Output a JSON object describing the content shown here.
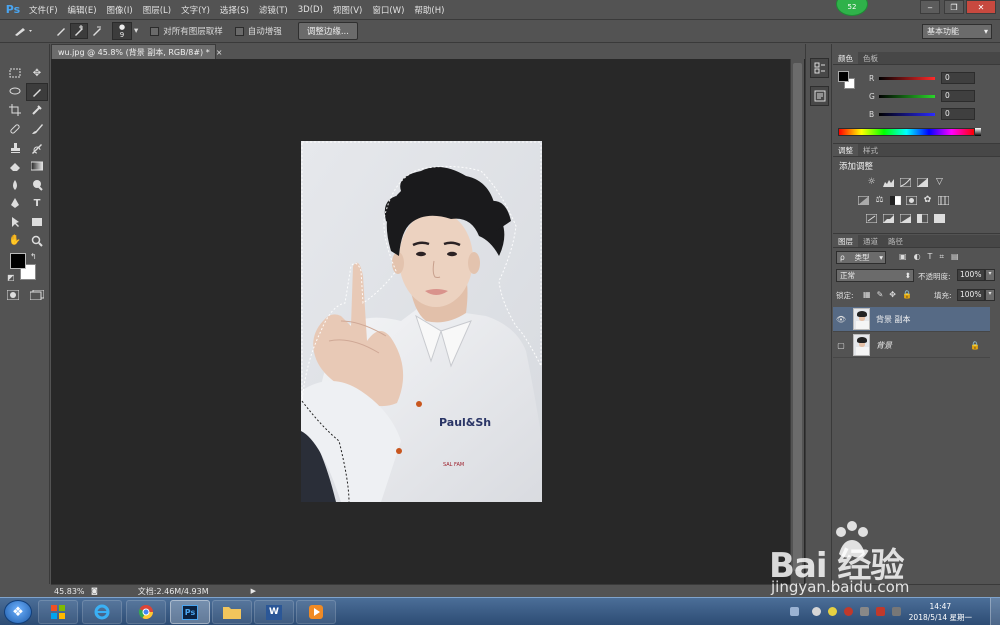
{
  "app": {
    "logo": "Ps",
    "notification_count": "52"
  },
  "menu": [
    "文件(F)",
    "编辑(E)",
    "图像(I)",
    "图层(L)",
    "文字(Y)",
    "选择(S)",
    "滤镜(T)",
    "3D(D)",
    "视图(V)",
    "窗口(W)",
    "帮助(H)"
  ],
  "window_controls": {
    "minimize": "‒",
    "restore": "❐",
    "close": "✕"
  },
  "options_bar": {
    "brush_size": "9",
    "sample_all_layers": "对所有图层取样",
    "auto_enhance": "自动增强",
    "refine_edge_button": "调整边缘...",
    "workspace": "基本功能"
  },
  "document": {
    "tab_title": "wu.jpg @ 45.8% (背景 副本, RGB/8#) *",
    "close": "×",
    "photo_text": "Paul&Sh",
    "photo_text2": "SAL FAM"
  },
  "status": {
    "zoom": "45.83%",
    "doc_size": "文档:2.46M/4.93M"
  },
  "color_panel": {
    "tabs": [
      "颜色",
      "色板"
    ],
    "channels": [
      {
        "label": "R",
        "value": "0",
        "color": "#ff2a2a"
      },
      {
        "label": "G",
        "value": "0",
        "color": "#2ad62a"
      },
      {
        "label": "B",
        "value": "0",
        "color": "#2a2aff"
      }
    ]
  },
  "adjust_panel": {
    "tabs": [
      "调整",
      "样式"
    ],
    "title": "添加调整"
  },
  "layers_panel": {
    "tabs": [
      "图层",
      "通道",
      "路径"
    ],
    "filter_kind": "类型",
    "blend_mode": "正常",
    "opacity_label": "不透明度:",
    "opacity": "100%",
    "lock_label": "锁定:",
    "fill_label": "填充:",
    "fill": "100%",
    "layers": [
      {
        "name": "背景 副本",
        "visible": true,
        "selected": true
      },
      {
        "name": "背景",
        "visible": false,
        "selected": false
      }
    ]
  },
  "taskbar": {
    "apps": [
      "windows-explorer",
      "internet-explorer",
      "chrome",
      "photoshop",
      "file-manager",
      "word",
      "media-player"
    ],
    "time": "14:47",
    "date": "2018/5/14 星期一"
  },
  "watermark": {
    "brand": "Bai 经验",
    "url": "jingyan.baidu.com"
  }
}
